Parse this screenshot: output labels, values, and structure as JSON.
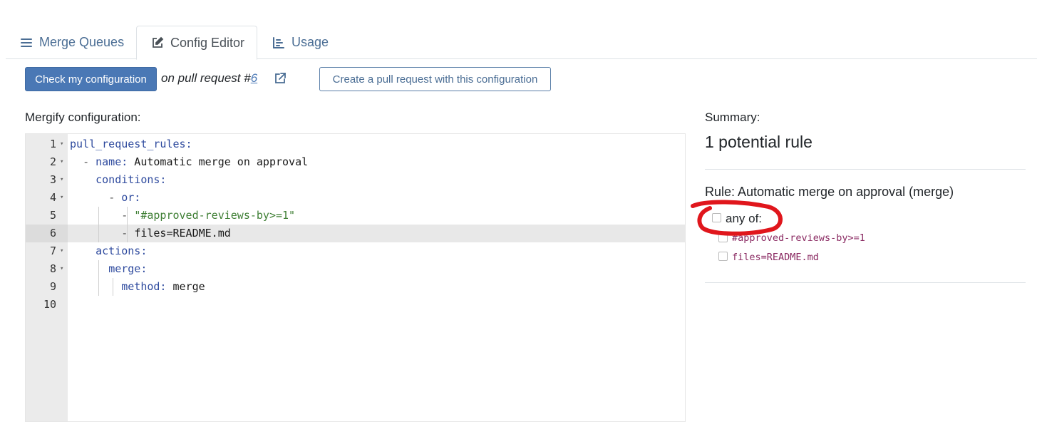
{
  "tabs": [
    {
      "label": "Merge Queues",
      "icon": "list-icon",
      "active": false
    },
    {
      "label": "Config Editor",
      "icon": "edit-icon",
      "active": true
    },
    {
      "label": "Usage",
      "icon": "chart-icon",
      "active": false
    }
  ],
  "toolbar": {
    "check_label": "Check my configuration",
    "pr_prefix": "on pull request #",
    "pr_number": "6",
    "external_icon": "external-link-icon",
    "create_label": "Create a pull request with this configuration"
  },
  "editor": {
    "label": "Mergify configuration:",
    "active_line": 6,
    "lines": [
      {
        "num": "1",
        "fold": true
      },
      {
        "num": "2",
        "fold": true
      },
      {
        "num": "3",
        "fold": true
      },
      {
        "num": "4",
        "fold": true
      },
      {
        "num": "5",
        "fold": false
      },
      {
        "num": "6",
        "fold": false
      },
      {
        "num": "7",
        "fold": true
      },
      {
        "num": "8",
        "fold": true
      },
      {
        "num": "9",
        "fold": false
      },
      {
        "num": "10",
        "fold": false
      }
    ],
    "code": {
      "l1_key": "pull_request_rules:",
      "l2_dash": "- ",
      "l2_key": "name:",
      "l2_val": " Automatic merge on approval",
      "l3_key": "conditions:",
      "l4_dash": "- ",
      "l4_key": "or:",
      "l5_dash": "- ",
      "l5_val": "\"#approved-reviews-by>=1\"",
      "l6_dash": "- ",
      "l6_val": "files=README.md",
      "l7_key": "actions:",
      "l8_key": "merge:",
      "l9_key": "method:",
      "l9_val": " merge"
    }
  },
  "summary": {
    "label": "Summary:",
    "count": "1 potential rule",
    "rule_title": "Rule: Automatic merge on approval (merge)",
    "group_label": "any of:",
    "conditions": [
      "#approved-reviews-by>=1",
      "files=README.md"
    ]
  },
  "colors": {
    "primary": "#4a78b5",
    "condition_text": "#8a2a62",
    "annotation": "#e0161c"
  }
}
